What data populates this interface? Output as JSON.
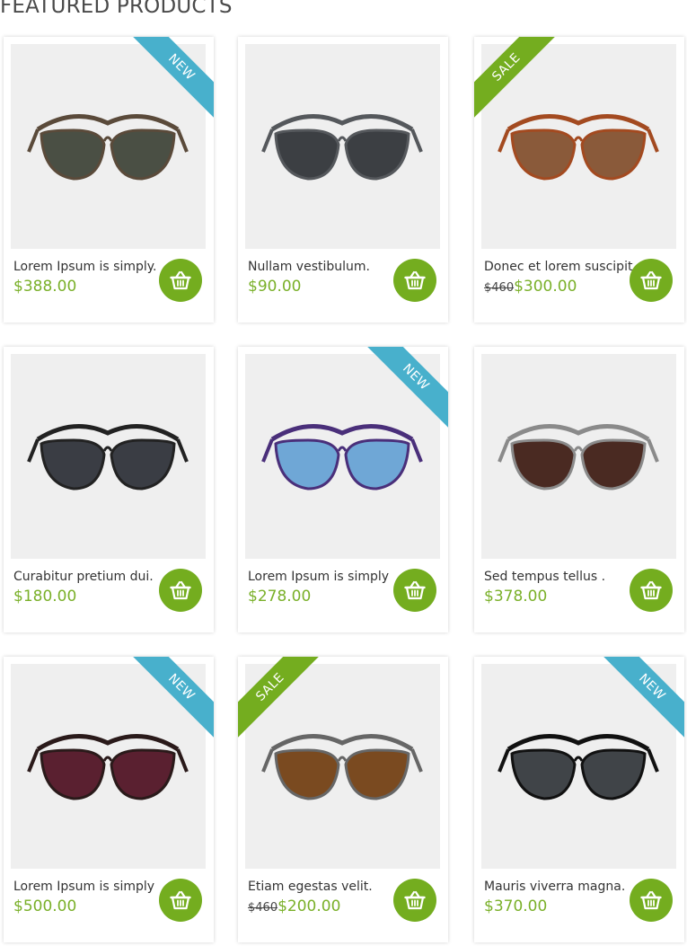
{
  "section": {
    "title": "FEATURED PRODUCTS"
  },
  "colors": {
    "accent": "#74ad1f",
    "ribbon_new": "#48b0cc",
    "ribbon_sale": "#74ad1f",
    "image_bg": "#efefef"
  },
  "cart_icon": "basket-icon",
  "products": [
    {
      "name": "Lorem Ipsum is simply.",
      "old_price": "",
      "price": "$388.00",
      "badge": "NEW",
      "lens": "#4a4f44",
      "frame": "#5a4a3a"
    },
    {
      "name": "Nullam vestibulum.",
      "old_price": "",
      "price": "$90.00",
      "badge": "",
      "lens": "#3c3f43",
      "frame": "#55585c"
    },
    {
      "name": "Donec et lorem suscipit.",
      "old_price": "$460",
      "price": "$300.00",
      "badge": "SALE",
      "lens": "#8a5a3a",
      "frame": "#a34a20"
    },
    {
      "name": "Curabitur pretium dui.",
      "old_price": "",
      "price": "$180.00",
      "badge": "",
      "lens": "#3a3d44",
      "frame": "#222222"
    },
    {
      "name": "Lorem Ipsum is simply",
      "old_price": "",
      "price": "$278.00",
      "badge": "NEW",
      "lens": "#6fa7d6",
      "frame": "#4a2f7a"
    },
    {
      "name": "Sed tempus tellus .",
      "old_price": "",
      "price": "$378.00",
      "badge": "",
      "lens": "#4a2a22",
      "frame": "#8a8a8a"
    },
    {
      "name": "Lorem Ipsum is simply",
      "old_price": "",
      "price": "$500.00",
      "badge": "NEW",
      "lens": "#5a2030",
      "frame": "#2a1a1a"
    },
    {
      "name": "Etiam egestas velit.",
      "old_price": "$460",
      "price": "$200.00",
      "badge": "SALE",
      "lens": "#7a4a20",
      "frame": "#666666"
    },
    {
      "name": "Mauris viverra magna.",
      "old_price": "",
      "price": "$370.00",
      "badge": "NEW",
      "lens": "#404448",
      "frame": "#111111"
    }
  ]
}
